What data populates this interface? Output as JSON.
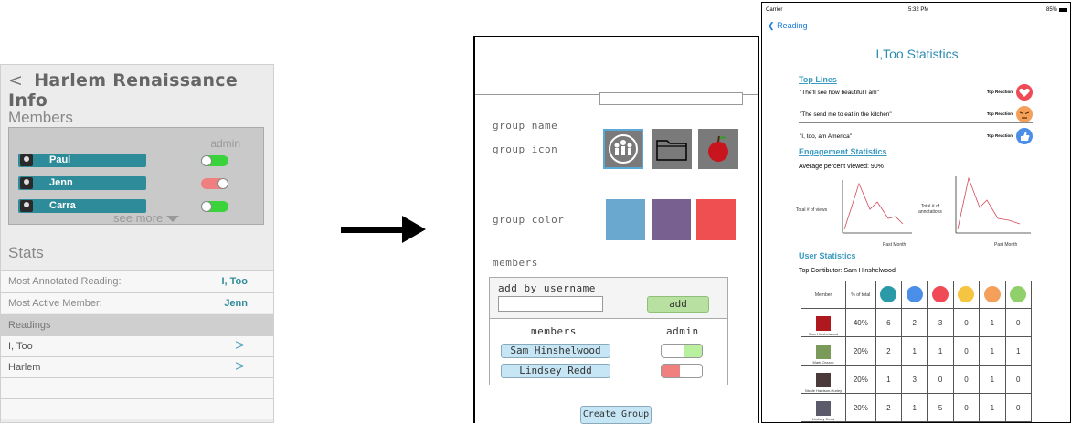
{
  "left_panel": {
    "title": "Harlem Renaissance Info",
    "back_chevron": "<",
    "members_heading": "Members",
    "admin_label": "admin",
    "members": [
      {
        "name": "Paul",
        "admin": true
      },
      {
        "name": "Jenn",
        "admin": false
      },
      {
        "name": "Carra",
        "admin": true
      }
    ],
    "see_more": "see more",
    "stats_heading": "Stats",
    "stats": [
      {
        "label": "Most Annotated Reading:",
        "value": "I, Too"
      },
      {
        "label": "Most Active Member:",
        "value": "Jenn"
      }
    ],
    "readings_heading": "Readings",
    "readings": [
      {
        "title": "I, Too",
        "go": ">"
      },
      {
        "title": "Harlem",
        "go": ">"
      }
    ]
  },
  "middle_panel": {
    "group_name_label": "group name",
    "group_name_value": "",
    "group_icon_label": "group icon",
    "group_icons": [
      "people-icon",
      "folder-icon",
      "apple-icon"
    ],
    "group_color_label": "group color",
    "group_colors": [
      "#6aa8d0",
      "#786090",
      "#ef4f50"
    ],
    "members_label": "members",
    "add_by_username_label": "add by username",
    "username_value": "",
    "add_button": "add",
    "members_col": "members",
    "admin_col": "admin",
    "members": [
      {
        "name": "Sam Hinshelwood",
        "admin": true
      },
      {
        "name": "Lindsey Redd",
        "admin": false
      }
    ],
    "create_button": "Create Group"
  },
  "right_panel": {
    "status_carrier": "Carrier",
    "status_time": "5:32 PM",
    "status_battery": "85%",
    "back_label": "Reading",
    "title": "I,Too Statistics",
    "top_lines_heading": "Top Lines",
    "top_reaction_label": "Top Reaction",
    "top_lines": [
      {
        "quote": "\"The'll see how beautiful I am\"",
        "reaction": "heart-icon",
        "color": "#ef4a55"
      },
      {
        "quote": "\"The send me to eat in the kitchen\"",
        "reaction": "angry-icon",
        "color": "#f5a05a"
      },
      {
        "quote": "\"I, too, am America\"",
        "reaction": "thumbs-up-icon",
        "color": "#4a8ee8"
      }
    ],
    "engagement_heading": "Engagement Statistics",
    "avg_viewed": "Average percent viewed: 90%",
    "chart1": {
      "ylabel": "Total # of views",
      "xlabel": "Past Month"
    },
    "chart2": {
      "ylabel": "Total # of annotations",
      "xlabel": "Past Month"
    },
    "user_stats_heading": "User Statistics",
    "top_contributor": "Top Contibutor: Sam Hinshelwood",
    "table": {
      "member_header": "Member",
      "pct_header": "% of total",
      "reaction_icons": [
        {
          "name": "comment-icon",
          "color": "#2a9aa8"
        },
        {
          "name": "thumbs-up-icon",
          "color": "#4a8ee8"
        },
        {
          "name": "heart-icon",
          "color": "#ef4a55"
        },
        {
          "name": "sad-icon",
          "color": "#f5c542"
        },
        {
          "name": "angry-icon",
          "color": "#f5a05a"
        },
        {
          "name": "question-icon",
          "color": "#8fd06a"
        }
      ],
      "rows": [
        {
          "name": "Sam Hinshelwood",
          "pct": "40%",
          "vals": [
            "6",
            "2",
            "3",
            "0",
            "1",
            "0"
          ]
        },
        {
          "name": "Mark Orozco",
          "pct": "20%",
          "vals": [
            "2",
            "1",
            "1",
            "0",
            "1",
            "1"
          ]
        },
        {
          "name": "Nicole Hardson-Hurley",
          "pct": "20%",
          "vals": [
            "1",
            "3",
            "0",
            "0",
            "1",
            "0"
          ]
        },
        {
          "name": "Lindsey Redd",
          "pct": "20%",
          "vals": [
            "2",
            "1",
            "5",
            "0",
            "1",
            "0"
          ]
        }
      ]
    }
  }
}
